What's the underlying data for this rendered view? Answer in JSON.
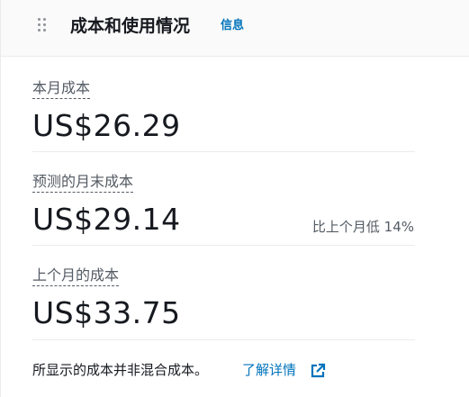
{
  "header": {
    "title": "成本和使用情况",
    "info_link": "信息",
    "drag_icon": "drag-handle-icon"
  },
  "metrics": [
    {
      "label": "本月成本",
      "value": "US$26.29"
    },
    {
      "label": "预测的月末成本",
      "value": "US$29.14",
      "comparison": "比上个月低 14%"
    },
    {
      "label": "上个月的成本",
      "value": "US$33.75"
    }
  ],
  "footer": {
    "note": "所显示的成本并非混合成本。",
    "link_label": "了解详情",
    "link_icon": "external-link-icon"
  },
  "colors": {
    "link": "#0073bb",
    "text": "#16191f",
    "secondary_text": "#545b64",
    "header_background": "#fafafa"
  }
}
